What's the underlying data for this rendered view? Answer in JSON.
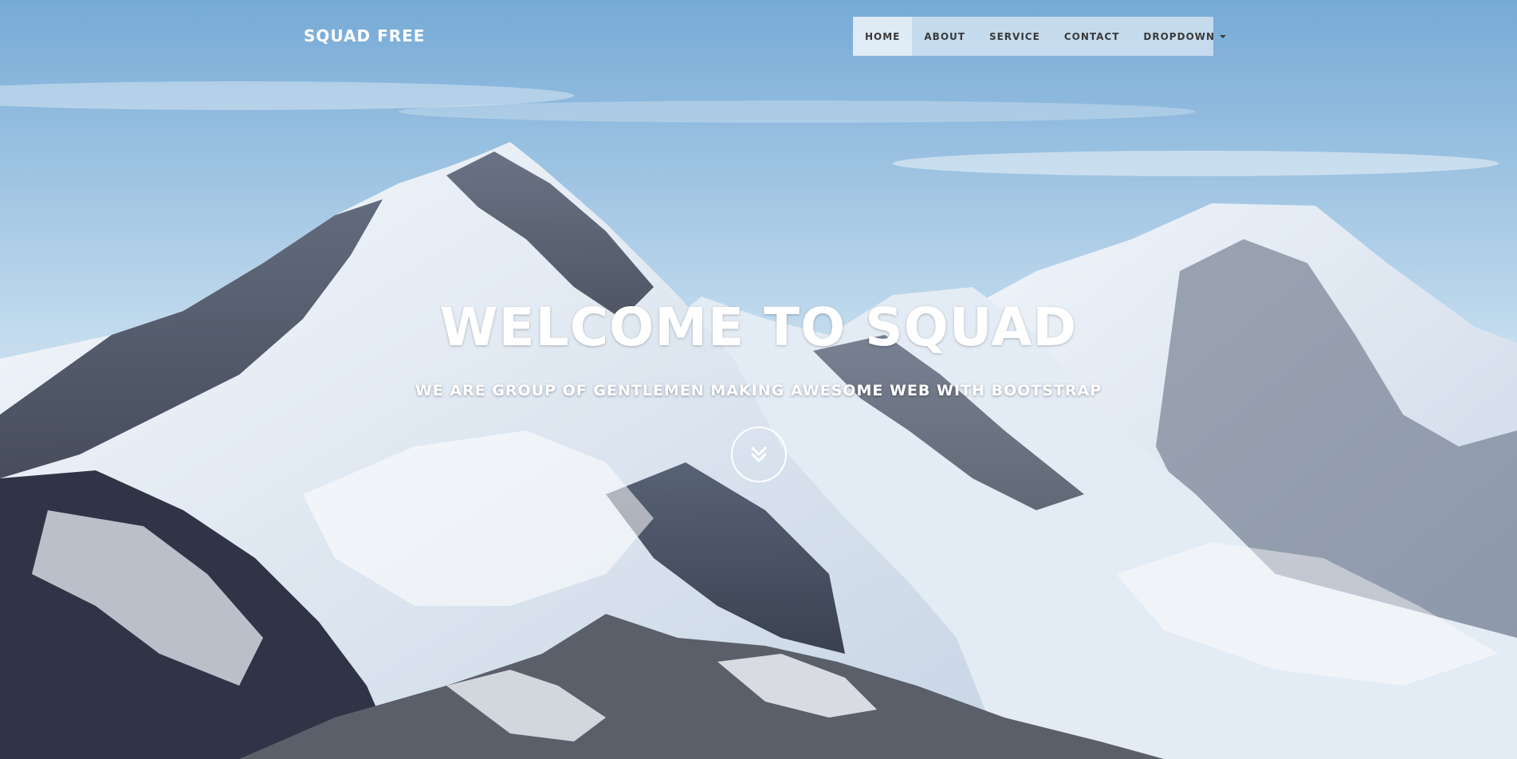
{
  "navbar": {
    "brand": "SQUAD FREE",
    "items": [
      {
        "label": "HOME",
        "active": true
      },
      {
        "label": "ABOUT"
      },
      {
        "label": "SERVICE"
      },
      {
        "label": "CONTACT"
      },
      {
        "label": "DROPDOWN",
        "has_caret": true
      }
    ]
  },
  "intro": {
    "heading": "WELCOME TO SQUAD",
    "subheading": "WE ARE GROUP OF GENTLEMEN MAKING AWESOME WEB WITH BOOTSTRAP",
    "scroll_icon": "double-chevron-down-icon"
  },
  "background": {
    "subject": "snow-capped-mountain-photo",
    "sky_color": "#8fbde0",
    "snow_color": "#f2f6fa",
    "rock_color": "#3d4558"
  }
}
